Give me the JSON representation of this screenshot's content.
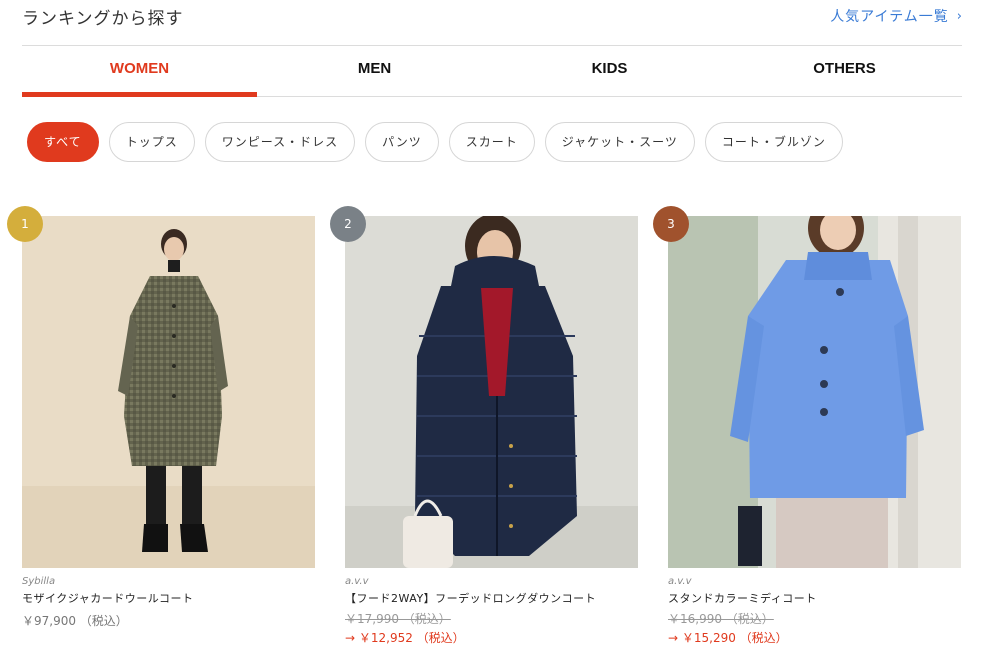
{
  "header": {
    "title": "ランキングから探す",
    "all_items_link": "人気アイテム一覧"
  },
  "tabs": [
    {
      "label": "WOMEN",
      "active": true
    },
    {
      "label": "MEN",
      "active": false
    },
    {
      "label": "KIDS",
      "active": false
    },
    {
      "label": "OTHERS",
      "active": false
    }
  ],
  "categories": [
    {
      "label": "すべて",
      "active": true
    },
    {
      "label": "トップス",
      "active": false
    },
    {
      "label": "ワンピース・ドレス",
      "active": false
    },
    {
      "label": "パンツ",
      "active": false
    },
    {
      "label": "スカート",
      "active": false
    },
    {
      "label": "ジャケット・スーツ",
      "active": false
    },
    {
      "label": "コート・ブルゾン",
      "active": false
    }
  ],
  "products": [
    {
      "rank": "1",
      "rank_color": "#d4ae3c",
      "brand": "Sybilla",
      "name": "モザイクジャカードウールコート",
      "price": "￥97,900 （税込）",
      "original_price": "",
      "sale_price": ""
    },
    {
      "rank": "2",
      "rank_color": "#7a8187",
      "brand": "a.v.v",
      "name": "【フード2WAY】フーデッドロングダウンコート",
      "price": "",
      "original_price": "￥17,990 （税込）",
      "sale_price": "→ ￥12,952 （税込）"
    },
    {
      "rank": "3",
      "rank_color": "#a0522d",
      "brand": "a.v.v",
      "name": "スタンドカラーミディコート",
      "price": "",
      "original_price": "￥16,990 （税込）",
      "sale_price": "→ ￥15,290 （税込）"
    }
  ],
  "colors": {
    "accent": "#e03a1e",
    "link": "#3a7bd5"
  },
  "icons": {
    "link_chevron": "chevron-right-icon"
  }
}
